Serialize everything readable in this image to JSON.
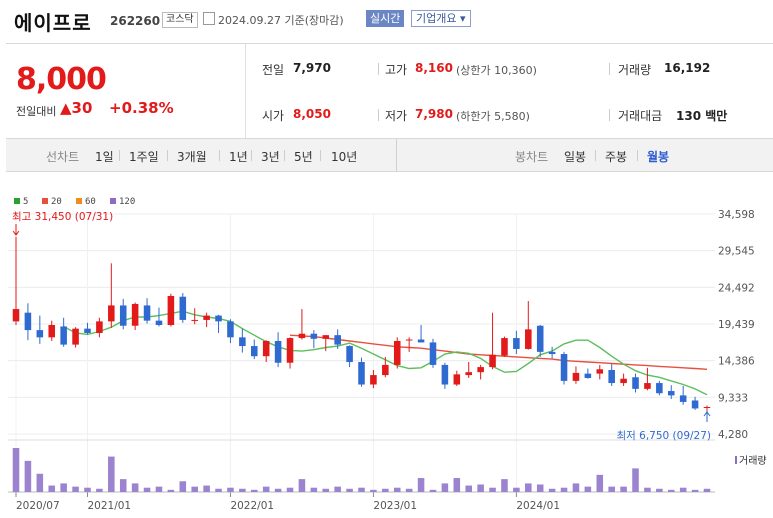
{
  "header": {
    "name": "에이프로",
    "code": "262260",
    "market": "코스닥",
    "date": "2024.09.27  기준(장마감)",
    "realtime": "실시간",
    "corp_info": "기업개요 ▾"
  },
  "summary": {
    "price": "8,000",
    "diff_label": "전일대비",
    "diff_value": "▲30",
    "diff_pct": "+0.38%",
    "prev_label": "전일",
    "prev": "7,970",
    "open_label": "시가",
    "open": "8,050",
    "high_label": "고가",
    "high": "8,160",
    "upper_limit": "(상한가 10,360)",
    "low_label": "저가",
    "low": "7,980",
    "lower_limit": "(하한가 5,580)",
    "volume_label": "거래량",
    "volume": "16,192",
    "amount_label": "거래대금",
    "amount": "130 백만"
  },
  "tabs": {
    "line_label": "선차트",
    "line": [
      "1일",
      "1주일",
      "3개월",
      "1년",
      "3년",
      "5년",
      "10년"
    ],
    "candle_label": "봉차트",
    "candle": [
      "일봉",
      "주봉",
      "월봉"
    ],
    "active": "월봉"
  },
  "chart_data": {
    "type": "candlestick",
    "legend": [
      {
        "name": "5",
        "color": "#2ca02c"
      },
      {
        "name": "20",
        "color": "#e8503e"
      },
      {
        "name": "60",
        "color": "#f08c1e"
      },
      {
        "name": "120",
        "color": "#8e6bc7"
      }
    ],
    "y_ticks": [
      "34,598",
      "29,545",
      "24,492",
      "19,439",
      "14,386",
      "9,333",
      "4,280"
    ],
    "y_range": [
      4280,
      34598
    ],
    "x_ticks": [
      "2020/07",
      "2021/01",
      "2022/01",
      "2023/01",
      "2024/01"
    ],
    "x_tick_index": [
      0,
      6,
      18,
      30,
      42
    ],
    "months": [
      "2020/07",
      "2020/08",
      "2020/09",
      "2020/10",
      "2020/11",
      "2020/12",
      "2021/01",
      "2021/02",
      "2021/03",
      "2021/04",
      "2021/05",
      "2021/06",
      "2021/07",
      "2021/08",
      "2021/09",
      "2021/10",
      "2021/11",
      "2021/12",
      "2022/01",
      "2022/02",
      "2022/03",
      "2022/04",
      "2022/05",
      "2022/06",
      "2022/07",
      "2022/08",
      "2022/09",
      "2022/10",
      "2022/11",
      "2022/12",
      "2023/01",
      "2023/02",
      "2023/03",
      "2023/04",
      "2023/05",
      "2023/06",
      "2023/07",
      "2023/08",
      "2023/09",
      "2023/10",
      "2023/11",
      "2023/12",
      "2024/01",
      "2024/02",
      "2024/03",
      "2024/04",
      "2024/05",
      "2024/06",
      "2024/07",
      "2024/08",
      "2024/09"
    ],
    "candles": [
      {
        "o": 19800,
        "h": 31450,
        "l": 19300,
        "c": 21500
      },
      {
        "o": 21000,
        "h": 22300,
        "l": 17200,
        "c": 18600
      },
      {
        "o": 18600,
        "h": 20600,
        "l": 16700,
        "c": 17600
      },
      {
        "o": 17600,
        "h": 19900,
        "l": 17100,
        "c": 19300
      },
      {
        "o": 19100,
        "h": 20300,
        "l": 16300,
        "c": 16600
      },
      {
        "o": 16600,
        "h": 19000,
        "l": 16200,
        "c": 18800
      },
      {
        "o": 18800,
        "h": 19600,
        "l": 18000,
        "c": 18200
      },
      {
        "o": 18200,
        "h": 20300,
        "l": 17600,
        "c": 19800
      },
      {
        "o": 19800,
        "h": 27800,
        "l": 18900,
        "c": 22000
      },
      {
        "o": 22000,
        "h": 22900,
        "l": 18700,
        "c": 19200
      },
      {
        "o": 19200,
        "h": 22400,
        "l": 18600,
        "c": 22200
      },
      {
        "o": 22000,
        "h": 23000,
        "l": 19500,
        "c": 19900
      },
      {
        "o": 19900,
        "h": 21700,
        "l": 19100,
        "c": 19300
      },
      {
        "o": 19300,
        "h": 23600,
        "l": 19100,
        "c": 23300
      },
      {
        "o": 23200,
        "h": 23700,
        "l": 19600,
        "c": 20000
      },
      {
        "o": 20000,
        "h": 21600,
        "l": 19400,
        "c": 20000
      },
      {
        "o": 20000,
        "h": 21000,
        "l": 19000,
        "c": 20600
      },
      {
        "o": 20600,
        "h": 20700,
        "l": 18200,
        "c": 19800
      },
      {
        "o": 19800,
        "h": 20100,
        "l": 16800,
        "c": 17600
      },
      {
        "o": 17600,
        "h": 18800,
        "l": 15500,
        "c": 16400
      },
      {
        "o": 16400,
        "h": 17300,
        "l": 14600,
        "c": 15000
      },
      {
        "o": 15000,
        "h": 17200,
        "l": 14200,
        "c": 17100
      },
      {
        "o": 17100,
        "h": 18300,
        "l": 13500,
        "c": 14100
      },
      {
        "o": 14100,
        "h": 17600,
        "l": 13300,
        "c": 17500
      },
      {
        "o": 17500,
        "h": 21500,
        "l": 17300,
        "c": 18100
      },
      {
        "o": 18100,
        "h": 18600,
        "l": 16100,
        "c": 17400
      },
      {
        "o": 17400,
        "h": 17900,
        "l": 15700,
        "c": 17900
      },
      {
        "o": 17900,
        "h": 18700,
        "l": 16000,
        "c": 16600
      },
      {
        "o": 16400,
        "h": 16500,
        "l": 13500,
        "c": 14200
      },
      {
        "o": 14200,
        "h": 14800,
        "l": 10800,
        "c": 11100
      },
      {
        "o": 11100,
        "h": 13100,
        "l": 10600,
        "c": 12400
      },
      {
        "o": 12400,
        "h": 14900,
        "l": 12100,
        "c": 13800
      },
      {
        "o": 13800,
        "h": 17600,
        "l": 13300,
        "c": 17100
      },
      {
        "o": 17200,
        "h": 17600,
        "l": 15600,
        "c": 17300
      },
      {
        "o": 17300,
        "h": 19300,
        "l": 16900,
        "c": 16900
      },
      {
        "o": 16900,
        "h": 17400,
        "l": 13400,
        "c": 13800
      },
      {
        "o": 13800,
        "h": 14100,
        "l": 10500,
        "c": 11100
      },
      {
        "o": 11100,
        "h": 13000,
        "l": 10900,
        "c": 12500
      },
      {
        "o": 12400,
        "h": 14200,
        "l": 12000,
        "c": 12800
      },
      {
        "o": 12800,
        "h": 13800,
        "l": 11800,
        "c": 13500
      },
      {
        "o": 13500,
        "h": 21000,
        "l": 13200,
        "c": 15200
      },
      {
        "o": 15100,
        "h": 17700,
        "l": 14900,
        "c": 17500
      },
      {
        "o": 17500,
        "h": 18500,
        "l": 15300,
        "c": 16000
      },
      {
        "o": 16000,
        "h": 22600,
        "l": 15900,
        "c": 18700
      },
      {
        "o": 19200,
        "h": 19300,
        "l": 14900,
        "c": 15600
      },
      {
        "o": 15600,
        "h": 16300,
        "l": 14700,
        "c": 15300
      },
      {
        "o": 15300,
        "h": 15600,
        "l": 11100,
        "c": 11600
      },
      {
        "o": 11600,
        "h": 13600,
        "l": 11200,
        "c": 12700
      },
      {
        "o": 12600,
        "h": 13300,
        "l": 11900,
        "c": 12000
      },
      {
        "o": 12600,
        "h": 13800,
        "l": 11800,
        "c": 13200
      },
      {
        "o": 13100,
        "h": 13900,
        "l": 10900,
        "c": 11300
      },
      {
        "o": 11300,
        "h": 12600,
        "l": 10900,
        "c": 11900
      },
      {
        "o": 12100,
        "h": 12600,
        "l": 10000,
        "c": 10500
      },
      {
        "o": 10500,
        "h": 13400,
        "l": 10300,
        "c": 11300
      },
      {
        "o": 11300,
        "h": 11600,
        "l": 9600,
        "c": 9900
      },
      {
        "o": 10200,
        "h": 11000,
        "l": 9100,
        "c": 9600
      },
      {
        "o": 9600,
        "h": 10900,
        "l": 8300,
        "c": 8700
      },
      {
        "o": 8900,
        "h": 9400,
        "l": 7600,
        "c": 7800
      },
      {
        "o": 7900,
        "h": 8200,
        "l": 6750,
        "c": 8000
      }
    ],
    "ma5": [
      null,
      null,
      null,
      null,
      19100,
      18200,
      18000,
      18400,
      19000,
      19900,
      20400,
      20400,
      20600,
      20900,
      21200,
      20700,
      20400,
      20200,
      19800,
      18800,
      17900,
      17000,
      16300,
      15800,
      15700,
      15900,
      16200,
      16400,
      16800,
      16100,
      15300,
      14500,
      13700,
      13300,
      13400,
      14300,
      15300,
      15600,
      15400,
      14700,
      13600,
      12800,
      12900,
      14000,
      15200,
      15700,
      16700,
      17200,
      17200,
      16200,
      15000,
      13900,
      13000,
      12400,
      12100,
      11600,
      11100,
      10500,
      9700
    ],
    "ma20": [
      null,
      null,
      null,
      null,
      null,
      null,
      null,
      null,
      null,
      null,
      null,
      null,
      null,
      null,
      null,
      null,
      null,
      null,
      null,
      null,
      null,
      null,
      null,
      17900,
      17800,
      17700,
      17500,
      17300,
      17100,
      16900,
      16700,
      16500,
      16300,
      16200,
      16100,
      15900,
      15700,
      15500,
      15300,
      15200,
      15100,
      15000,
      14900,
      14800,
      14700,
      14600,
      14400,
      14300,
      14200,
      14100,
      14000,
      13900,
      13800,
      13700,
      13600,
      13500,
      13400,
      13300,
      13200
    ],
    "volume": [
      8.2,
      5.8,
      3.4,
      1.2,
      1.6,
      1.0,
      0.8,
      0.6,
      6.6,
      2.4,
      1.6,
      0.8,
      1.0,
      0.4,
      2.0,
      1.0,
      1.2,
      0.6,
      0.8,
      0.6,
      0.4,
      1.0,
      0.6,
      0.8,
      2.4,
      0.8,
      0.6,
      1.0,
      0.6,
      0.8,
      0.4,
      0.6,
      0.8,
      0.6,
      2.6,
      0.4,
      1.6,
      2.6,
      1.2,
      1.4,
      0.8,
      2.4,
      0.8,
      1.6,
      1.4,
      0.6,
      0.8,
      1.6,
      1.0,
      3.2,
      1.0,
      1.0,
      4.4,
      0.8,
      0.6,
      0.4,
      0.8,
      0.4,
      0.6,
      0.4,
      0.4,
      0.3
    ],
    "high_annotation": "최고 31,450 (07/31)",
    "low_annotation": "최저 6,750 (09/27)",
    "volume_label": "거래량"
  }
}
